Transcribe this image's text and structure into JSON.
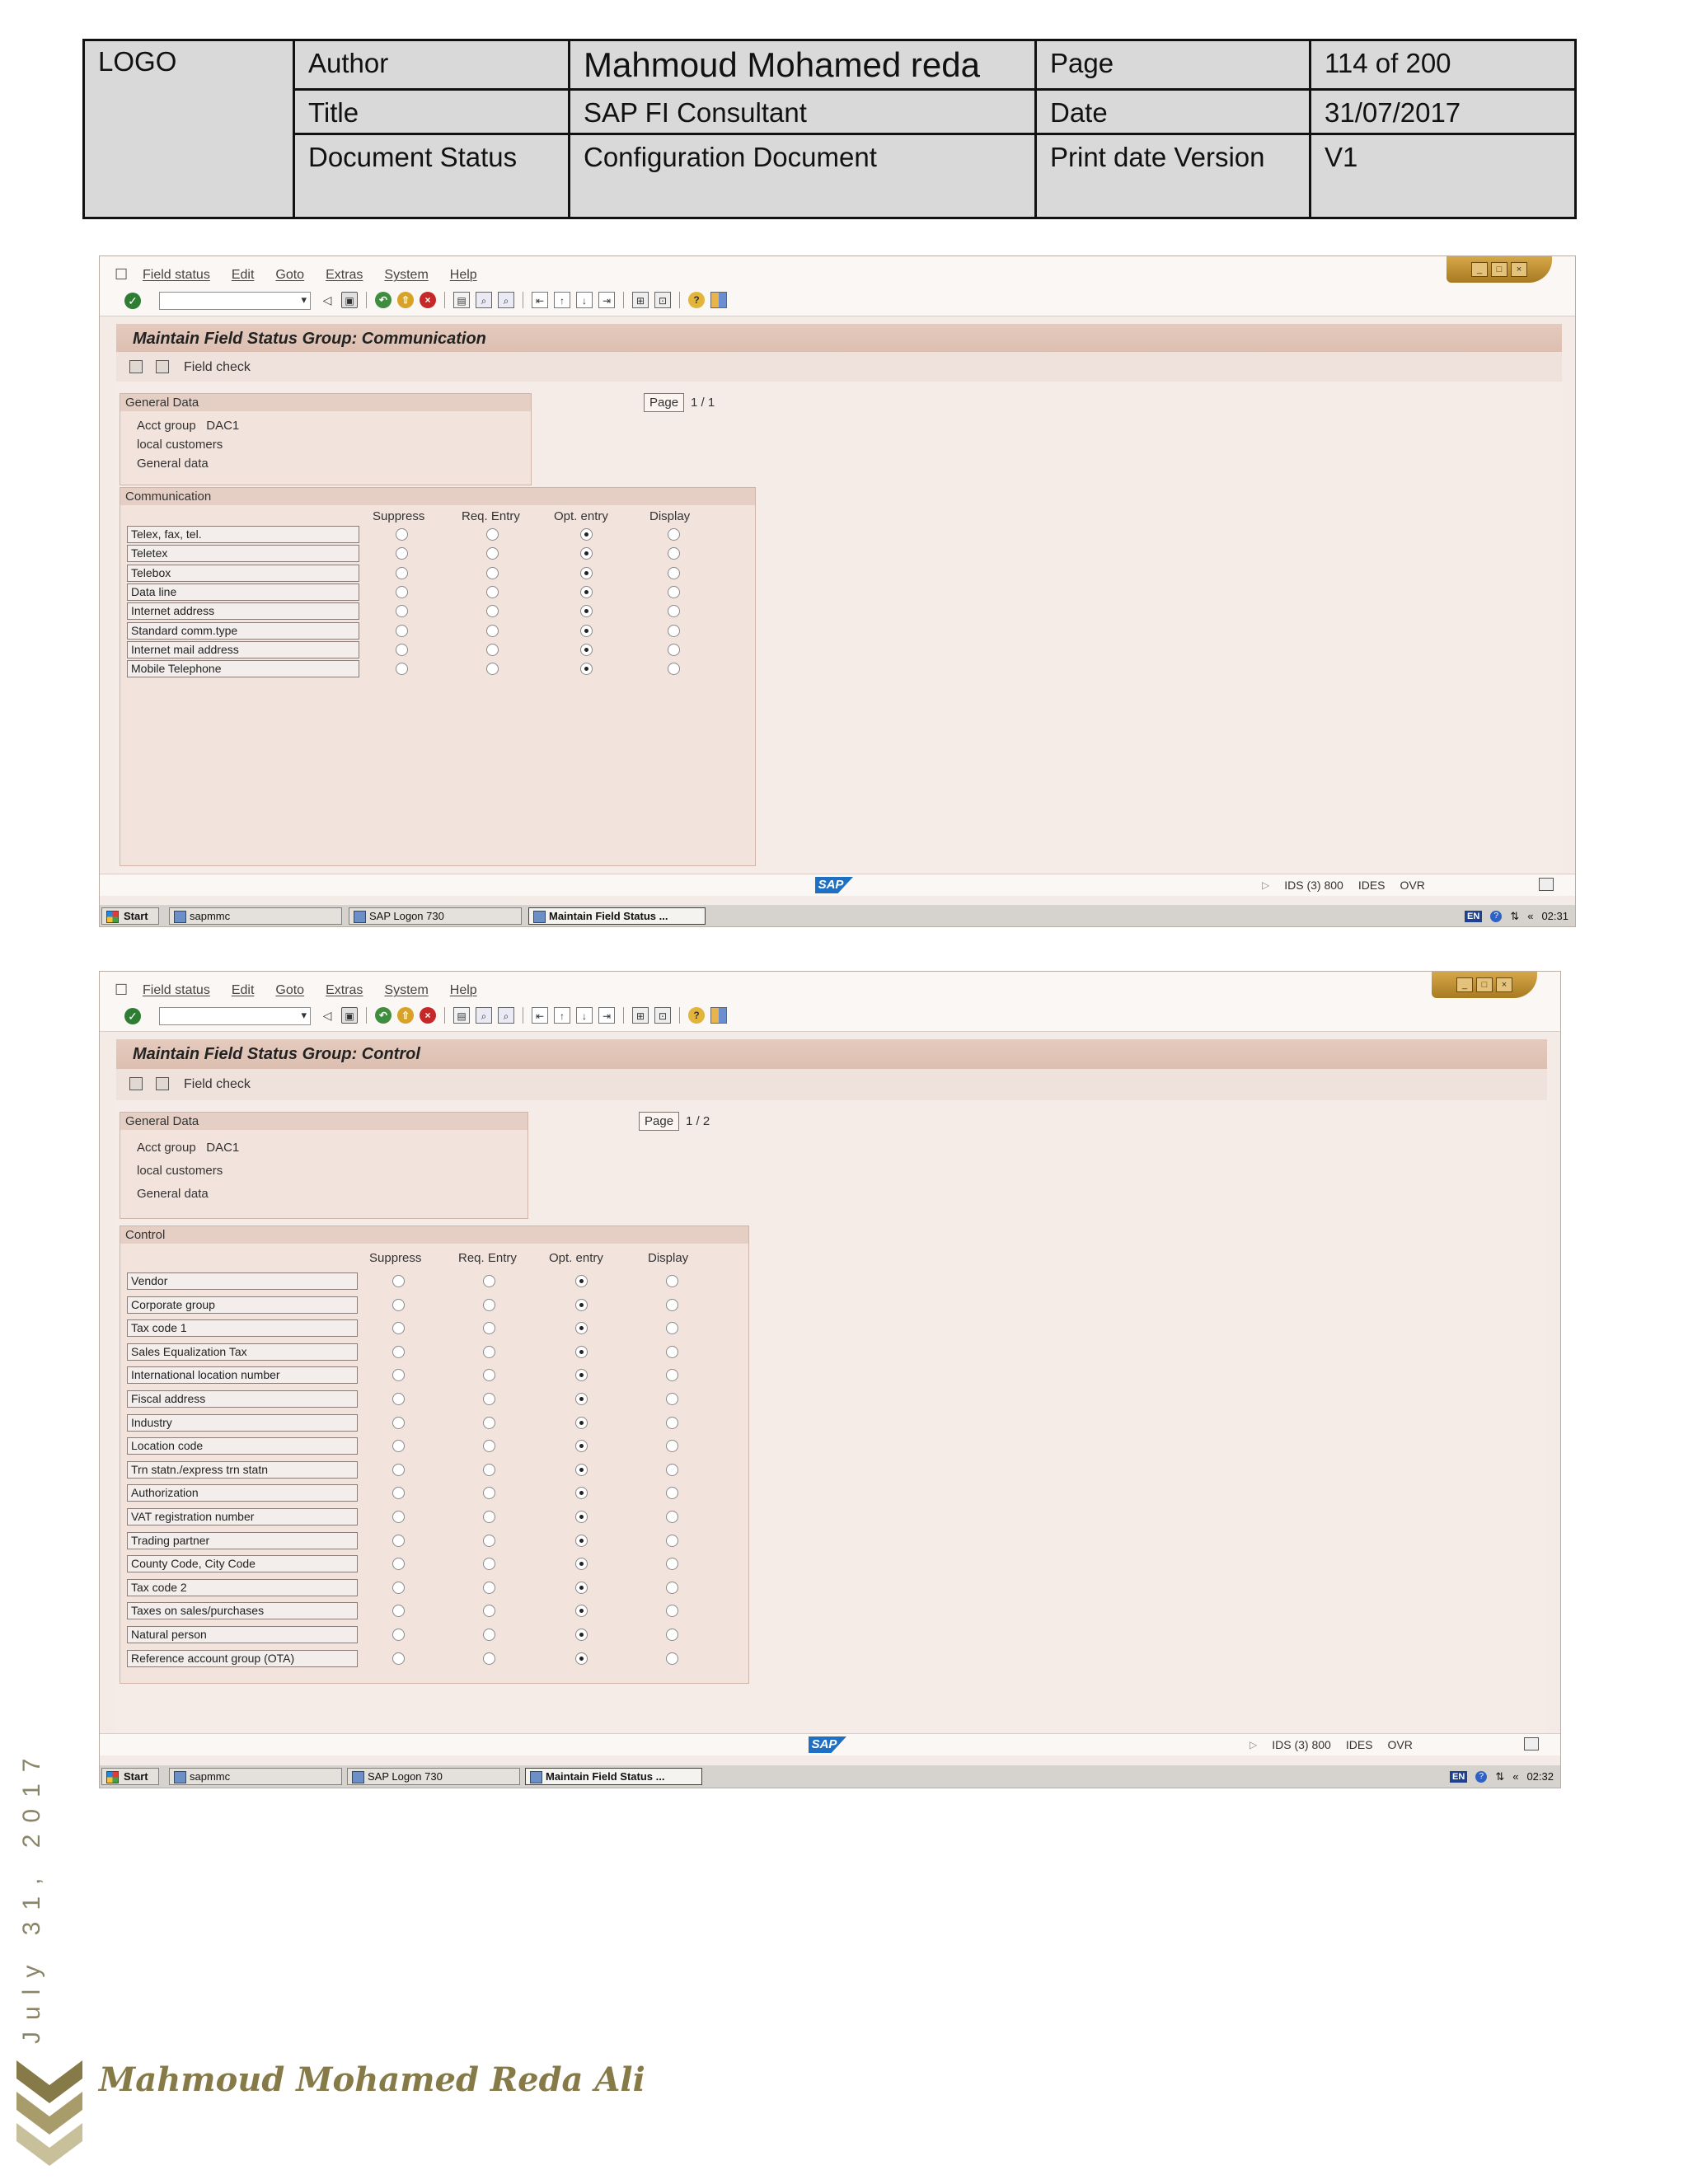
{
  "header": {
    "logo": "LOGO",
    "author_label": "Author",
    "author_value": "Mahmoud Mohamed reda",
    "page_label": "Page",
    "page_value": "114 of 200",
    "title_label": "Title",
    "title_value": "SAP FI Consultant",
    "date_label": "Date",
    "date_value": "31/07/2017",
    "status_label": "Document Status",
    "status_value": "Configuration Document",
    "version_label": "Print date Version",
    "version_value": "V1"
  },
  "menu": [
    "Field status",
    "Edit",
    "Goto",
    "Extras",
    "System",
    "Help"
  ],
  "columns": [
    "Suppress",
    "Req. Entry",
    "Opt. entry",
    "Display"
  ],
  "general": {
    "title": "General Data",
    "acct_group": "Acct group",
    "acct_value": "DAC1",
    "line2": "local customers",
    "line3": "General data"
  },
  "app_toolbar": {
    "field_check": "Field check"
  },
  "page_word": "Page",
  "screen1": {
    "title": "Maintain Field Status Group: Communication",
    "page": "1  /  1",
    "group_title": "Communication",
    "fields": [
      "Telex, fax, tel.",
      "Teletex",
      "Telebox",
      "Data line",
      "Internet address",
      "Standard comm.type",
      "Internet mail address",
      "Mobile Telephone"
    ],
    "selected": "Opt. entry"
  },
  "screen2": {
    "title": "Maintain Field Status Group: Control",
    "page": "1  /  2",
    "group_title": "Control",
    "fields": [
      "Vendor",
      "Corporate group",
      "Tax code 1",
      "Sales Equalization Tax",
      "International location number",
      "Fiscal address",
      "Industry",
      "Location code",
      "Trn statn./express trn statn",
      "Authorization",
      "VAT registration number",
      "Trading partner",
      "County Code, City Code",
      "Tax code 2",
      "Taxes on sales/purchases",
      "Natural person",
      "Reference account group (OTA)"
    ],
    "selected": "Opt. entry"
  },
  "status": {
    "sap_logo": "SAP",
    "system": "IDS (3) 800",
    "client": "IDES",
    "mode": "OVR"
  },
  "taskbar": {
    "start": "Start",
    "task1": "sapmmc",
    "task2": "SAP Logon 730",
    "task3": "Maintain Field Status ...",
    "lang": "EN",
    "time1": "02:31",
    "time2": "02:32"
  },
  "footer": {
    "date": "July 31, 2017",
    "name": "Mahmoud Mohamed Reda Ali"
  },
  "colors": {
    "accent": "#857a48",
    "sap_bg": "#f5ebe6",
    "title_bar": "#e5cabd"
  }
}
